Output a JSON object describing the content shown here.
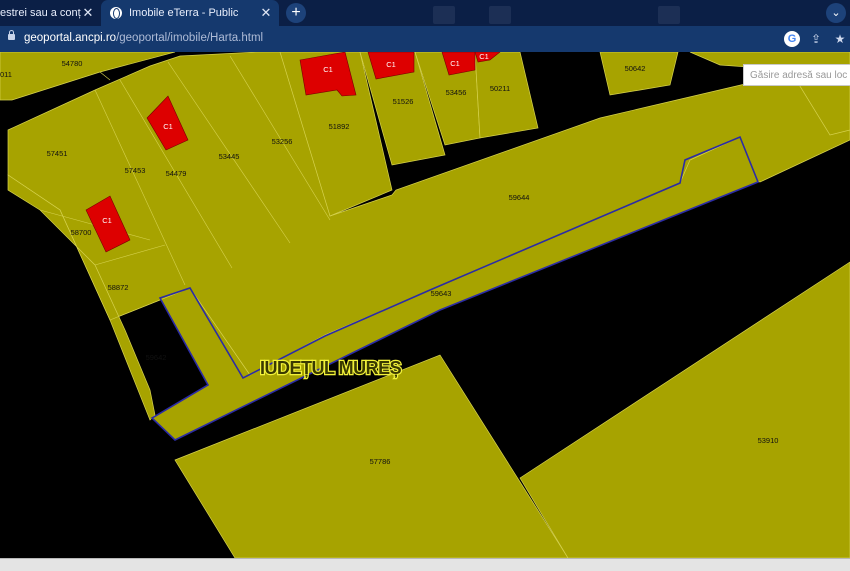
{
  "browser": {
    "tabs": [
      {
        "title": "estrei sau a conținutu",
        "active": false
      },
      {
        "title": "Imobile eTerra - Public",
        "active": true
      }
    ],
    "url_host": "geoportal.ancpi.ro",
    "url_path": "/geoportal/imobile/Harta.html"
  },
  "map": {
    "county_label": "IUDEȚUL MUREȘ",
    "search_placeholder": "Găsire adresă sau loc",
    "parcels": [
      "54780",
      "011",
      "57451",
      "57453",
      "54479",
      "53445",
      "53256",
      "51892",
      "51526",
      "53456",
      "50211",
      "50642",
      "59644",
      "58700",
      "58872",
      "59643",
      "59642",
      "57786",
      "53910"
    ],
    "buildings": [
      "C1",
      "C1",
      "C1",
      "C1",
      "C1",
      "C1"
    ],
    "colors": {
      "parcel_fill": "#a7a300",
      "parcel_border": "#d6d24e",
      "building_fill": "#dd0000",
      "highlight_border": "#2b2ba6",
      "background": "#000000"
    }
  }
}
